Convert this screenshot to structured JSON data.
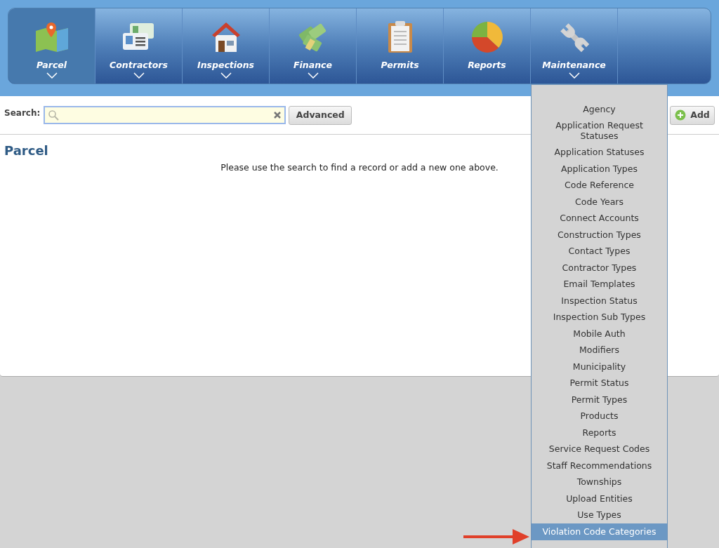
{
  "nav": {
    "tabs": [
      {
        "label": "Parcel",
        "kind": "map",
        "selected": true,
        "has_menu": true
      },
      {
        "label": "Contractors",
        "kind": "cards",
        "selected": false,
        "has_menu": true
      },
      {
        "label": "Inspections",
        "kind": "house",
        "selected": false,
        "has_menu": true
      },
      {
        "label": "Finance",
        "kind": "money",
        "selected": false,
        "has_menu": true
      },
      {
        "label": "Permits",
        "kind": "clipboard",
        "selected": false,
        "has_menu": false
      },
      {
        "label": "Reports",
        "kind": "pie",
        "selected": false,
        "has_menu": false
      },
      {
        "label": "Maintenance",
        "kind": "wrench",
        "selected": false,
        "has_menu": true
      }
    ]
  },
  "search": {
    "label": "Search:",
    "advanced_button": "Advanced",
    "add_button": "Add"
  },
  "page": {
    "title": "Parcel",
    "message": "Please use the search to find a record or add a new one above."
  },
  "maintenance_menu": {
    "items": [
      {
        "label": "Agency",
        "selected": false
      },
      {
        "label": "Application Request Statuses",
        "selected": false
      },
      {
        "label": "Application Statuses",
        "selected": false
      },
      {
        "label": "Application Types",
        "selected": false
      },
      {
        "label": "Code Reference",
        "selected": false
      },
      {
        "label": "Code Years",
        "selected": false
      },
      {
        "label": "Connect Accounts",
        "selected": false
      },
      {
        "label": "Construction Types",
        "selected": false
      },
      {
        "label": "Contact Types",
        "selected": false
      },
      {
        "label": "Contractor Types",
        "selected": false
      },
      {
        "label": "Email Templates",
        "selected": false
      },
      {
        "label": "Inspection Status",
        "selected": false
      },
      {
        "label": "Inspection Sub Types",
        "selected": false
      },
      {
        "label": "Mobile Auth",
        "selected": false
      },
      {
        "label": "Modifiers",
        "selected": false
      },
      {
        "label": "Municipality",
        "selected": false
      },
      {
        "label": "Permit Status",
        "selected": false
      },
      {
        "label": "Permit Types",
        "selected": false
      },
      {
        "label": "Products",
        "selected": false
      },
      {
        "label": "Reports",
        "selected": false
      },
      {
        "label": "Service Request Codes",
        "selected": false
      },
      {
        "label": "Staff Recommendations",
        "selected": false
      },
      {
        "label": "Townships",
        "selected": false
      },
      {
        "label": "Upload Entities",
        "selected": false
      },
      {
        "label": "Use Types",
        "selected": false
      },
      {
        "label": "Violation Code Categories",
        "selected": true
      }
    ]
  }
}
